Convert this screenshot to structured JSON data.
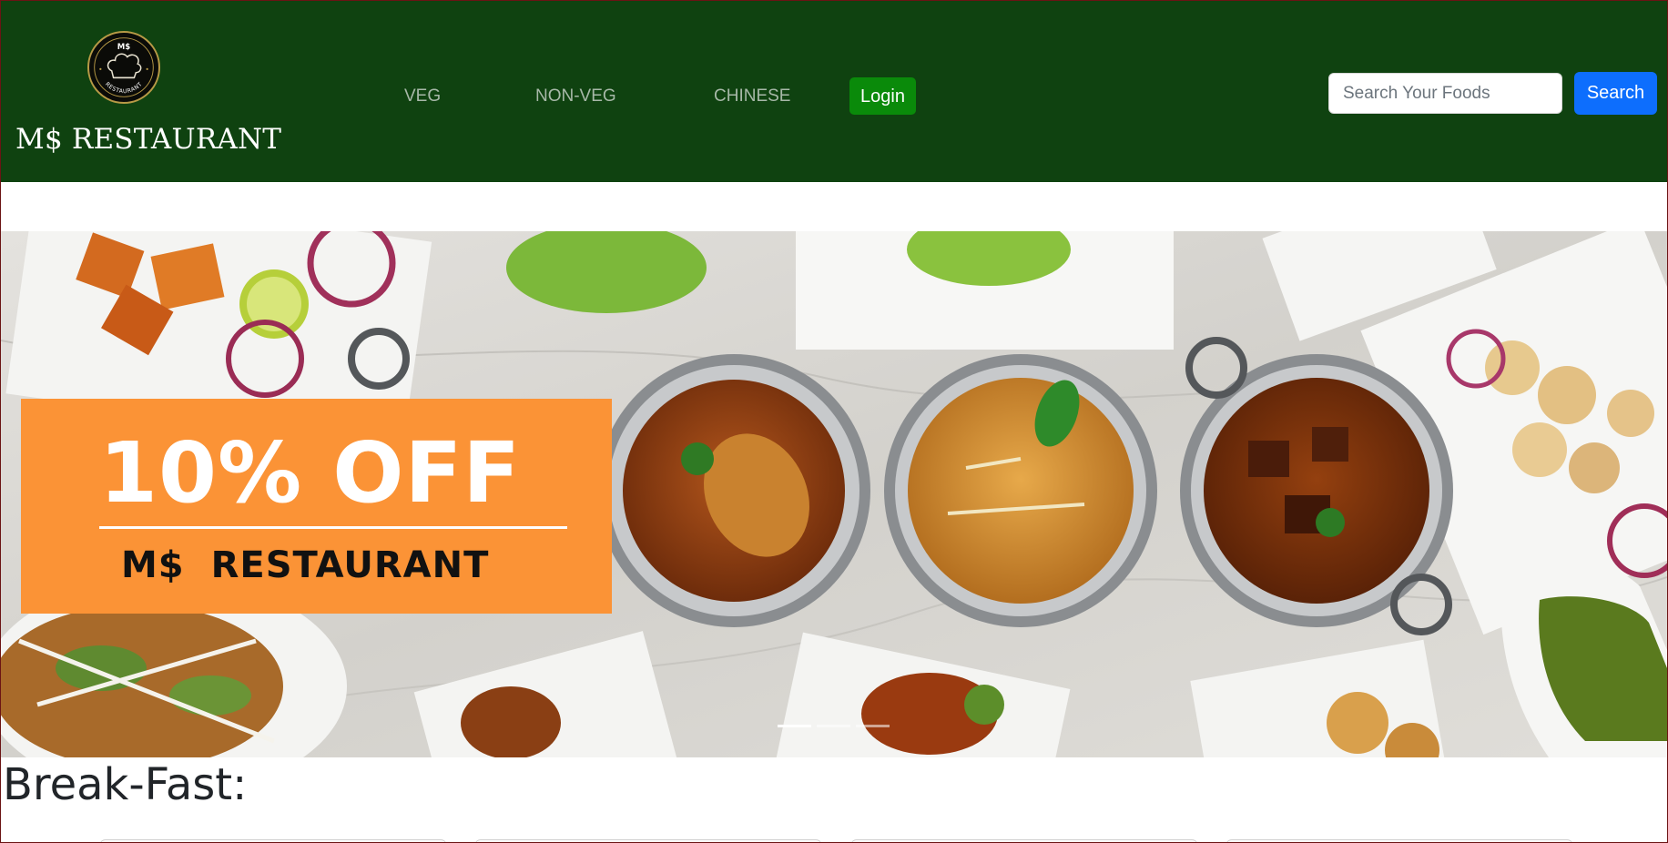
{
  "navbar": {
    "brand": "M$ RESTAURANT",
    "logo": {
      "top_text": "M$",
      "ring_text": "RESTAURANT",
      "icon": "chef-hat-icon"
    },
    "links": [
      {
        "label": "VEG"
      },
      {
        "label": "NON-VEG"
      },
      {
        "label": "CHINESE"
      }
    ],
    "login_label": "Login",
    "search": {
      "placeholder": "Search Your Foods",
      "value": "",
      "button_label": "Search"
    }
  },
  "carousel": {
    "promo": {
      "headline": "10% OFF",
      "subline": "M$ RESTAURANT"
    },
    "slide_count": 3,
    "active_slide": 1
  },
  "sections": [
    {
      "title": "Break-Fast:",
      "visible_cards": 4
    }
  ],
  "colors": {
    "navbar_bg": "#0f4210",
    "login_button": "#0a8a0a",
    "search_button": "#0d6efd",
    "promo_bg": "#fb9336"
  }
}
